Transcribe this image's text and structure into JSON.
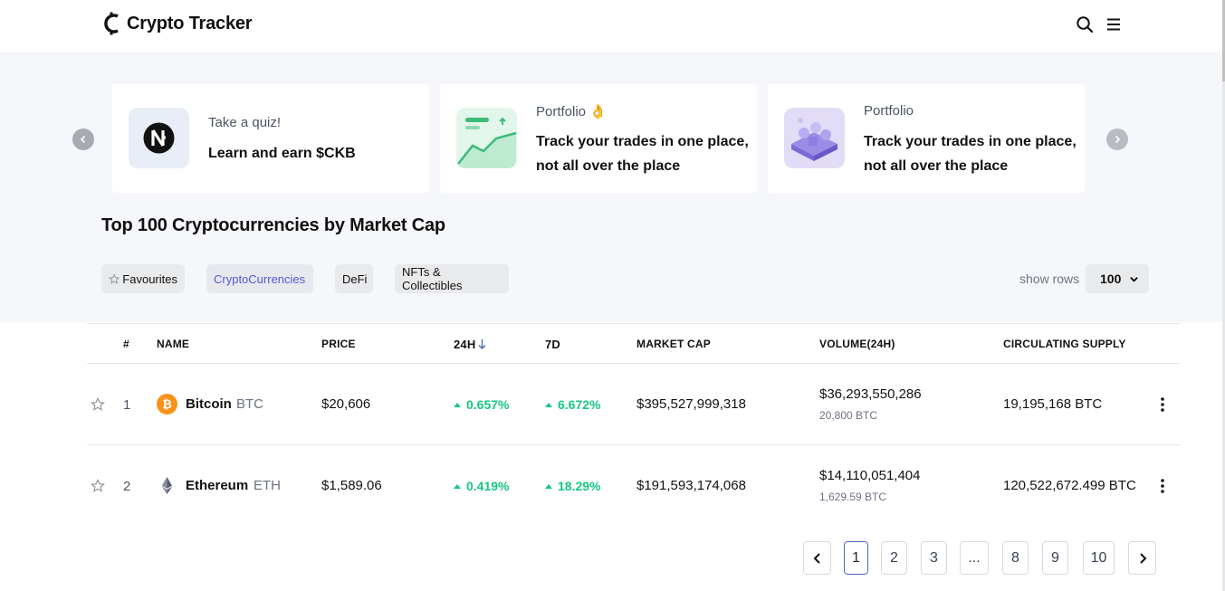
{
  "header": {
    "brand": "Crypto Tracker"
  },
  "carousel": {
    "cards": [
      {
        "eyebrow": "Take a quiz!",
        "title": "Learn and earn $CKB"
      },
      {
        "eyebrow": "Portfolio 👌",
        "title": "Track your trades in one place, not all over the place"
      },
      {
        "eyebrow": "Portfolio",
        "title": "Track your trades in one place, not all over the place"
      }
    ]
  },
  "main": {
    "title": "Top 100 Cryptocurrencies by Market Cap",
    "filters": {
      "favourites": "Favourites",
      "crypto": "CryptoCurrencies",
      "defi": "DeFi",
      "nft": "NFTs & Collectibles"
    },
    "active_filter": "CryptoCurrencies",
    "show_rows_label": "show rows",
    "show_rows_value": "100"
  },
  "table": {
    "headers": {
      "rank": "#",
      "name": "NAME",
      "price": "PRICE",
      "change_24h": "24H",
      "change_7d": "7D",
      "market_cap": "MARKET CAP",
      "volume": "VOLUME(24H)",
      "supply": "CIRCULATING SUPPLY"
    },
    "sort_column": "24H",
    "rows": [
      {
        "rank": "1",
        "name": "Bitcoin",
        "symbol": "BTC",
        "icon": "bitcoin-icon",
        "price": "$20,606",
        "change_24h": "0.657%",
        "change_7d": "6.672%",
        "market_cap": "$395,527,999,318",
        "volume": "$36,293,550,286",
        "volume_sub": "20,800 BTC",
        "supply": "19,195,168 BTC"
      },
      {
        "rank": "2",
        "name": "Ethereum",
        "symbol": "ETH",
        "icon": "ethereum-icon",
        "price": "$1,589.06",
        "change_24h": "0.419%",
        "change_7d": "18.29%",
        "market_cap": "$191,593,174,068",
        "volume": "$14,110,051,404",
        "volume_sub": "1,629.59 BTC",
        "supply": "120,522,672.499 BTC"
      }
    ]
  },
  "pagination": {
    "pages": [
      "1",
      "2",
      "3",
      "...",
      "8",
      "9",
      "10"
    ],
    "current": "1"
  },
  "colors": {
    "positive": "#16c784",
    "accent": "#4f5bd5",
    "bitcoin": "#f7931a",
    "band": "#f6f7fa"
  }
}
